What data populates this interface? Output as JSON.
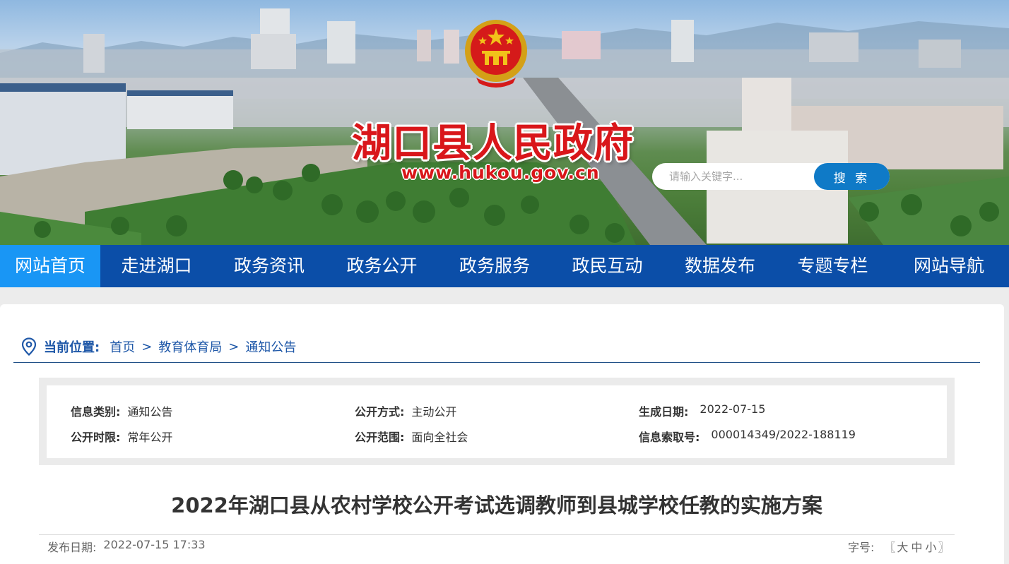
{
  "header": {
    "site_title": "湖口县人民政府",
    "site_url": "www.hukou.gov.cn",
    "search_placeholder": "请输入关键字...",
    "search_button": "搜 索"
  },
  "nav": {
    "items": [
      {
        "label": "网站首页",
        "active": true
      },
      {
        "label": "走进湖口",
        "active": false
      },
      {
        "label": "政务资讯",
        "active": false
      },
      {
        "label": "政务公开",
        "active": false
      },
      {
        "label": "政务服务",
        "active": false
      },
      {
        "label": "政民互动",
        "active": false
      },
      {
        "label": "数据发布",
        "active": false
      },
      {
        "label": "专题专栏",
        "active": false
      },
      {
        "label": "网站导航",
        "active": false
      }
    ]
  },
  "breadcrumb": {
    "label": "当前位置:",
    "items": [
      "首页",
      "教育体育局",
      "通知公告"
    ],
    "separator": ">"
  },
  "info": {
    "category_label": "信息类别:",
    "category_value": "通知公告",
    "method_label": "公开方式:",
    "method_value": "主动公开",
    "date_label": "生成日期:",
    "date_value": "2022-07-15",
    "term_label": "公开时限:",
    "term_value": "常年公开",
    "scope_label": "公开范围:",
    "scope_value": "面向全社会",
    "index_label": "信息索取号:",
    "index_value": "000014349/2022-188119"
  },
  "article": {
    "title": "2022年湖口县从农村学校公开考试选调教师到县城学校任教的实施方案",
    "publish_label": "发布日期:",
    "publish_value": "2022-07-15 17:33",
    "fontsize_label": "字号:",
    "fontsize_open": "〖",
    "fontsize_large": "大",
    "fontsize_medium": "中",
    "fontsize_small": "小",
    "fontsize_close": "〗"
  },
  "colors": {
    "nav_bg": "#0b4ea8",
    "nav_active": "#1996f5",
    "title_red": "#d9161a",
    "search_btn": "#0f7ac7",
    "link_blue": "#1f58a8"
  }
}
